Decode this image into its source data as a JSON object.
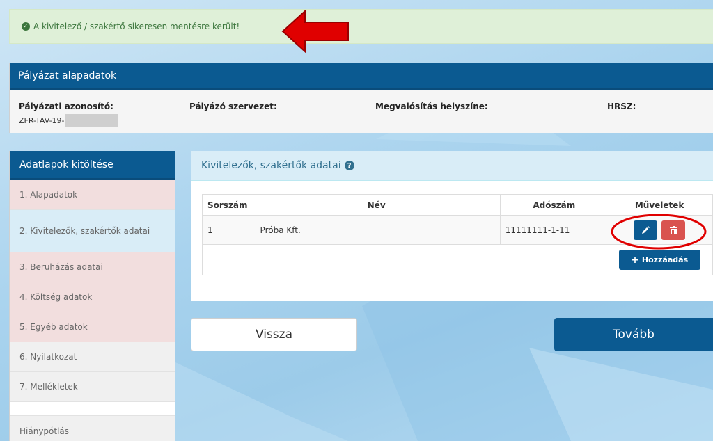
{
  "alert": {
    "message": "A kivitelező / szakértő sikeresen mentésre került!"
  },
  "project": {
    "title": "Pályázat alapadatok",
    "fields": [
      {
        "label": "Pályázati azonosító:",
        "value": "ZFR-TAV-19-"
      },
      {
        "label": "Pályázó szervezet:",
        "value": ""
      },
      {
        "label": "Megvalósítás helyszíne:",
        "value": ""
      },
      {
        "label": "HRSZ:",
        "value": ""
      }
    ]
  },
  "sidebar": {
    "title": "Adatlapok kitöltése",
    "items": [
      {
        "label": "1. Alapadatok"
      },
      {
        "label": "2. Kivitelezők, szakértők adatai"
      },
      {
        "label": "3. Beruházás adatai"
      },
      {
        "label": "4. Költség adatok"
      },
      {
        "label": "5. Egyéb adatok"
      },
      {
        "label": "6. Nyilatkozat"
      },
      {
        "label": "7. Mellékletek"
      },
      {
        "label": "Hiánypótlás"
      }
    ]
  },
  "content": {
    "title": "Kivitelezők, szakértők adatai",
    "table": {
      "headers": [
        "Sorszám",
        "Név",
        "Adószám",
        "Műveletek"
      ],
      "rows": [
        {
          "index": "1",
          "name": "Próba Kft.",
          "tax_number": "11111111-1-11"
        }
      ]
    },
    "add_label": "Hozzáadás"
  },
  "nav": {
    "back_label": "Vissza",
    "next_label": "Tovább"
  },
  "colors": {
    "primary": "#0b5a91",
    "success_bg": "#dff0d8",
    "danger": "#d9534f",
    "info_bg": "#d9edf7",
    "annotation_red": "#e00000"
  }
}
